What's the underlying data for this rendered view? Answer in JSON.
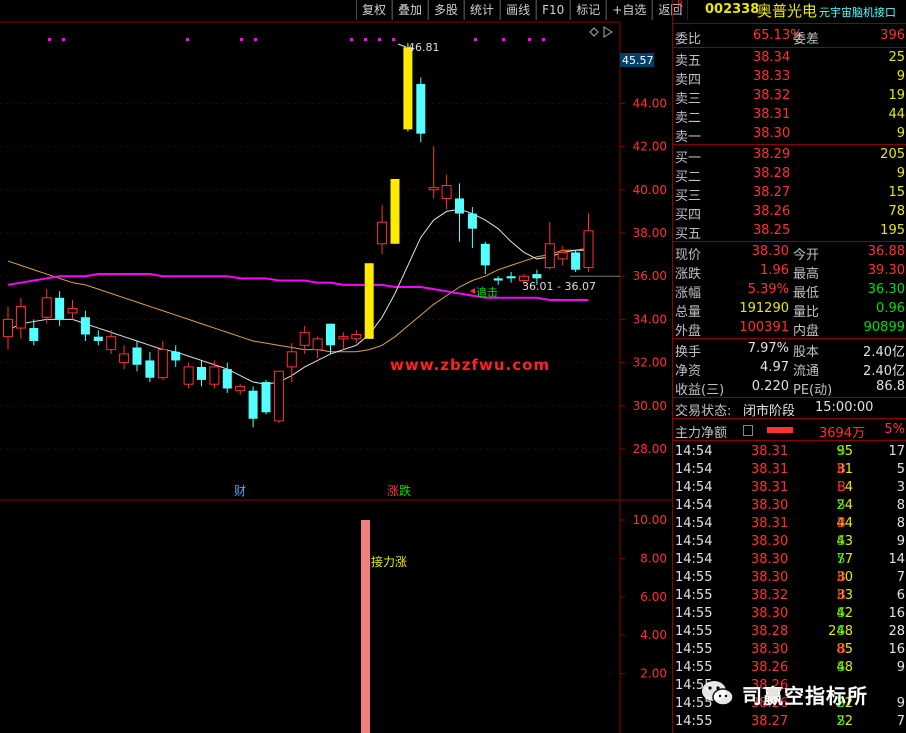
{
  "toolbar": {
    "buttons": [
      "复权",
      "叠加",
      "多股",
      "统计",
      "画线",
      "F10",
      "标记",
      "+自选",
      "返回"
    ]
  },
  "stock": {
    "market_flag": "R",
    "code": "002338",
    "name": "奥普光电",
    "source": "元宇宙脑机接口"
  },
  "chart_data": {
    "type": "candlestick",
    "ylim": [
      27,
      48
    ],
    "y_ticks": [
      28.0,
      30.0,
      32.0,
      34.0,
      36.0,
      38.0,
      40.0,
      42.0,
      44.0
    ],
    "candles": [
      {
        "o": 33.2,
        "c": 34.0,
        "h": 34.6,
        "l": 32.6,
        "s": "up"
      },
      {
        "o": 33.6,
        "c": 34.6,
        "h": 35.0,
        "l": 33.1,
        "s": "up"
      },
      {
        "o": 33.6,
        "c": 33.0,
        "h": 34.0,
        "l": 32.8,
        "s": "down"
      },
      {
        "o": 34.1,
        "c": 35.0,
        "h": 35.4,
        "l": 33.8,
        "s": "up"
      },
      {
        "o": 35.0,
        "c": 34.0,
        "h": 35.3,
        "l": 33.7,
        "s": "down"
      },
      {
        "o": 34.3,
        "c": 34.5,
        "h": 34.9,
        "l": 34.0,
        "s": "up"
      },
      {
        "o": 34.1,
        "c": 33.3,
        "h": 34.4,
        "l": 33.0,
        "s": "down"
      },
      {
        "o": 33.2,
        "c": 33.0,
        "h": 33.5,
        "l": 32.8,
        "s": "down"
      },
      {
        "o": 32.6,
        "c": 33.2,
        "h": 33.5,
        "l": 32.4,
        "s": "up"
      },
      {
        "o": 32.4,
        "c": 32.0,
        "h": 32.8,
        "l": 31.7,
        "s": "up"
      },
      {
        "o": 32.7,
        "c": 31.9,
        "h": 33.0,
        "l": 31.6,
        "s": "down"
      },
      {
        "o": 32.1,
        "c": 31.3,
        "h": 32.5,
        "l": 31.1,
        "s": "down"
      },
      {
        "o": 31.3,
        "c": 32.6,
        "h": 33.0,
        "l": 31.2,
        "s": "up"
      },
      {
        "o": 32.1,
        "c": 32.5,
        "h": 32.8,
        "l": 31.8,
        "s": "down"
      },
      {
        "o": 31.0,
        "c": 31.8,
        "h": 32.0,
        "l": 30.8,
        "s": "up"
      },
      {
        "o": 31.8,
        "c": 31.2,
        "h": 32.1,
        "l": 30.9,
        "s": "down"
      },
      {
        "o": 31.0,
        "c": 31.8,
        "h": 32.1,
        "l": 30.8,
        "s": "up"
      },
      {
        "o": 31.7,
        "c": 30.8,
        "h": 32.0,
        "l": 30.6,
        "s": "down"
      },
      {
        "o": 30.7,
        "c": 30.9,
        "h": 31.0,
        "l": 30.5,
        "s": "up"
      },
      {
        "o": 30.7,
        "c": 29.4,
        "h": 30.9,
        "l": 29.0,
        "s": "down"
      },
      {
        "o": 29.7,
        "c": 31.1,
        "h": 31.2,
        "l": 29.6,
        "s": "down"
      },
      {
        "o": 29.3,
        "c": 31.6,
        "h": 31.6,
        "l": 29.2,
        "s": "up"
      },
      {
        "o": 31.8,
        "c": 32.5,
        "h": 32.9,
        "l": 31.1,
        "s": "up"
      },
      {
        "o": 32.8,
        "c": 33.4,
        "h": 33.7,
        "l": 32.4,
        "s": "up"
      },
      {
        "o": 32.6,
        "c": 33.1,
        "h": 33.2,
        "l": 32.2,
        "s": "up"
      },
      {
        "o": 33.8,
        "c": 32.8,
        "h": 33.8,
        "l": 32.4,
        "s": "down"
      },
      {
        "o": 33.1,
        "c": 33.2,
        "h": 33.4,
        "l": 32.6,
        "s": "up"
      },
      {
        "o": 33.1,
        "c": 33.3,
        "h": 33.5,
        "l": 32.9,
        "s": "up"
      },
      {
        "o": 33.1,
        "c": 36.6,
        "h": 36.6,
        "l": 33.1,
        "s": "limit"
      },
      {
        "o": 37.5,
        "c": 38.5,
        "h": 39.3,
        "l": 37.0,
        "s": "up"
      },
      {
        "o": 37.5,
        "c": 40.5,
        "h": 40.5,
        "l": 37.5,
        "s": "limit"
      },
      {
        "o": 42.8,
        "c": 46.6,
        "h": 46.8,
        "l": 42.7,
        "s": "limit"
      },
      {
        "o": 44.9,
        "c": 42.6,
        "h": 45.2,
        "l": 42.2,
        "s": "down"
      },
      {
        "o": 40.0,
        "c": 40.1,
        "h": 42.0,
        "l": 39.6,
        "s": "up"
      },
      {
        "o": 40.2,
        "c": 39.6,
        "h": 40.7,
        "l": 39.1,
        "s": "up"
      },
      {
        "o": 39.6,
        "c": 38.9,
        "h": 40.3,
        "l": 37.6,
        "s": "down"
      },
      {
        "o": 38.9,
        "c": 38.2,
        "h": 39.2,
        "l": 37.3,
        "s": "down"
      },
      {
        "o": 37.5,
        "c": 36.5,
        "h": 37.6,
        "l": 36.1,
        "s": "down"
      },
      {
        "o": 35.9,
        "c": 35.8,
        "h": 36.0,
        "l": 35.6,
        "s": "down"
      },
      {
        "o": 35.9,
        "c": 36.0,
        "h": 36.2,
        "l": 35.7,
        "s": "down"
      },
      {
        "o": 36.0,
        "c": 35.8,
        "h": 36.1,
        "l": 35.6,
        "s": "up"
      },
      {
        "o": 35.9,
        "c": 36.1,
        "h": 36.3,
        "l": 35.6,
        "s": "down"
      },
      {
        "o": 36.4,
        "c": 37.5,
        "h": 38.5,
        "l": 36.3,
        "s": "up"
      },
      {
        "o": 36.8,
        "c": 37.1,
        "h": 37.4,
        "l": 36.5,
        "s": "up"
      },
      {
        "o": 37.1,
        "c": 36.3,
        "h": 37.2,
        "l": 36.2,
        "s": "down"
      },
      {
        "o": 36.4,
        "c": 38.1,
        "h": 38.9,
        "l": 36.2,
        "s": "up"
      }
    ],
    "ma_white": [
      33.5,
      33.8,
      33.9,
      34.0,
      34.0,
      34.0,
      33.8,
      33.6,
      33.4,
      33.2,
      33.0,
      32.8,
      32.6,
      32.5,
      32.3,
      32.1,
      31.9,
      31.7,
      31.4,
      31.1,
      31.0,
      31.1,
      31.4,
      31.8,
      32.1,
      32.4,
      32.6,
      32.8,
      33.3,
      34.1,
      35.2,
      36.5,
      37.8,
      38.6,
      39.0,
      39.1,
      38.9,
      38.6,
      38.2,
      37.6,
      37.1,
      36.8,
      36.9,
      37.1,
      37.2,
      37.2
    ],
    "ma_orange": [
      36.7,
      36.5,
      36.3,
      36.1,
      35.9,
      35.7,
      35.6,
      35.4,
      35.2,
      35.0,
      34.8,
      34.6,
      34.4,
      34.2,
      34.0,
      33.8,
      33.6,
      33.4,
      33.2,
      33.0,
      32.9,
      32.8,
      32.7,
      32.6,
      32.6,
      32.5,
      32.5,
      32.5,
      32.6,
      32.8,
      33.2,
      33.7,
      34.2,
      34.7,
      35.1,
      35.5,
      35.8,
      36.0,
      36.3,
      36.5,
      36.7,
      36.9,
      37.0,
      37.2,
      37.2,
      37.3
    ],
    "ma_magenta": [
      35.6,
      35.7,
      35.8,
      35.9,
      36.0,
      36.0,
      36.0,
      36.1,
      36.1,
      36.1,
      36.1,
      36.1,
      36.0,
      36.0,
      36.0,
      36.0,
      36.0,
      36.0,
      35.9,
      35.9,
      35.9,
      35.8,
      35.8,
      35.8,
      35.7,
      35.7,
      35.6,
      35.6,
      35.6,
      35.6,
      35.5,
      35.5,
      35.5,
      35.4,
      35.3,
      35.2,
      35.1,
      35.0,
      35.0,
      35.0,
      35.0,
      35.0,
      34.9,
      34.9,
      34.9,
      34.9
    ],
    "high_label": "46.81",
    "current_price_tag": "45.57",
    "range_label": "36.01 - 36.07",
    "markers": {
      "cai": "财",
      "zhangdie": "涨跌",
      "zhuiji": "追击"
    },
    "sub_chart": {
      "ylim": [
        0,
        11
      ],
      "y_ticks": [
        2.0,
        4.0,
        6.0,
        8.0,
        10.0
      ],
      "bar_value": 10,
      "label": "接力涨"
    }
  },
  "watermark": "www.zbzfwu.com",
  "quote": {
    "weibi": {
      "label": "委比",
      "value": "65.13%",
      "label2": "委差",
      "value2": "396"
    },
    "asks": [
      {
        "label": "卖五",
        "price": "38.34",
        "vol": "25"
      },
      {
        "label": "卖四",
        "price": "38.33",
        "vol": "9"
      },
      {
        "label": "卖三",
        "price": "38.32",
        "vol": "19"
      },
      {
        "label": "卖二",
        "price": "38.31",
        "vol": "44"
      },
      {
        "label": "卖一",
        "price": "38.30",
        "vol": "9"
      }
    ],
    "bids": [
      {
        "label": "买一",
        "price": "38.29",
        "vol": "205"
      },
      {
        "label": "买二",
        "price": "38.28",
        "vol": "9"
      },
      {
        "label": "买三",
        "price": "38.27",
        "vol": "15"
      },
      {
        "label": "买四",
        "price": "38.26",
        "vol": "78"
      },
      {
        "label": "买五",
        "price": "38.25",
        "vol": "195"
      }
    ],
    "stats1": [
      {
        "l1": "现价",
        "v1": "38.30",
        "c1": "#ff3030",
        "l2": "今开",
        "v2": "36.88",
        "c2": "#ff3030"
      },
      {
        "l1": "涨跌",
        "v1": "1.96",
        "c1": "#ff3030",
        "l2": "最高",
        "v2": "39.30",
        "c2": "#ff3030"
      },
      {
        "l1": "涨幅",
        "v1": "5.39%",
        "c1": "#ff3030",
        "l2": "最低",
        "v2": "36.30",
        "c2": "#00e000"
      },
      {
        "l1": "总量",
        "v1": "191290",
        "c1": "#e8e800",
        "l2": "量比",
        "v2": "0.96",
        "c2": "#00e000"
      },
      {
        "l1": "外盘",
        "v1": "100391",
        "c1": "#ff3030",
        "l2": "内盘",
        "v2": "90899",
        "c2": "#00e000"
      }
    ],
    "stats2": [
      {
        "l1": "换手",
        "v1": "7.97%",
        "l2": "股本",
        "v2": "2.40亿"
      },
      {
        "l1": "净资",
        "v1": "4.97",
        "l2": "流通",
        "v2": "2.40亿"
      },
      {
        "l1": "收益(三)",
        "v1": "0.220",
        "l2": "PE(动)",
        "v2": "86.8"
      }
    ],
    "trade_status": {
      "label": "交易状态:",
      "status": "闭市阶段",
      "time": "15:00:00"
    },
    "main_flow": {
      "label": "主力净额",
      "amount": "3694万",
      "pct": "5%"
    }
  },
  "ticks": [
    {
      "t": "14:54",
      "p": "38.31",
      "v": "95",
      "d": "S",
      "n": "17"
    },
    {
      "t": "14:54",
      "p": "38.31",
      "v": "31",
      "d": "B",
      "n": "5"
    },
    {
      "t": "14:54",
      "p": "38.31",
      "v": "4",
      "d": "B",
      "n": "3"
    },
    {
      "t": "14:54",
      "p": "38.30",
      "v": "24",
      "d": "S",
      "n": "8"
    },
    {
      "t": "14:54",
      "p": "38.31",
      "v": "44",
      "d": "B",
      "n": "8"
    },
    {
      "t": "14:54",
      "p": "38.30",
      "v": "43",
      "d": "S",
      "n": "9"
    },
    {
      "t": "14:54",
      "p": "38.30",
      "v": "77",
      "d": "S",
      "n": "14"
    },
    {
      "t": "14:55",
      "p": "38.30",
      "v": "30",
      "d": "B",
      "n": "7"
    },
    {
      "t": "14:55",
      "p": "38.32",
      "v": "33",
      "d": "B",
      "n": "6"
    },
    {
      "t": "14:55",
      "p": "38.30",
      "v": "42",
      "d": "S",
      "n": "16"
    },
    {
      "t": "14:55",
      "p": "38.28",
      "v": "248",
      "d": "S",
      "n": "28"
    },
    {
      "t": "14:55",
      "p": "38.30",
      "v": "85",
      "d": "B",
      "n": "16"
    },
    {
      "t": "14:55",
      "p": "38.26",
      "v": "48",
      "d": "S",
      "n": "9"
    },
    {
      "t": "14:55",
      "p": "38.26",
      "v": "",
      "d": "",
      "n": ""
    },
    {
      "t": "14:55",
      "p": "38.26",
      "v": "22",
      "d": "S",
      "n": "9"
    },
    {
      "t": "14:55",
      "p": "38.27",
      "v": "22",
      "d": "S",
      "n": "7"
    }
  ],
  "wechat_label": "司赢空指标所",
  "colors": {
    "up": "#ff3030",
    "down": "#54ffff",
    "limit": "#ffea00",
    "panel_border": "#8b0000",
    "white": "#e0e0e0",
    "green": "#00e000",
    "yellow": "#e8e800"
  }
}
